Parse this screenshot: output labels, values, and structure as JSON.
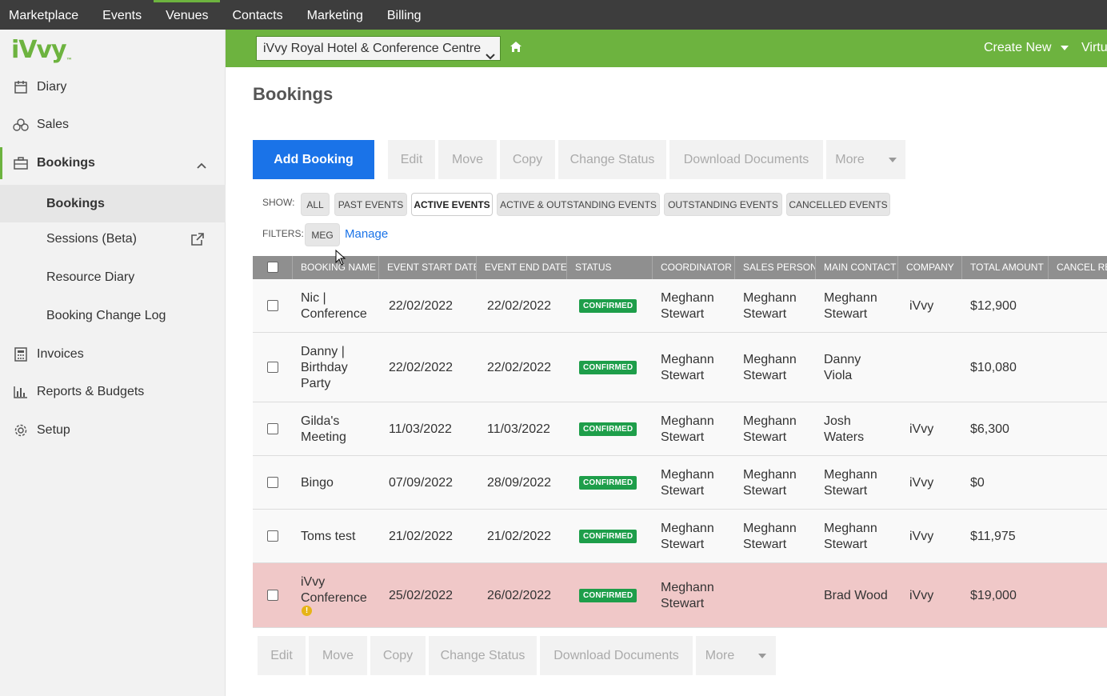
{
  "topnav": [
    "Marketplace",
    "Events",
    "Venues",
    "Contacts",
    "Marketing",
    "Billing"
  ],
  "topnav_active": "Venues",
  "logo": {
    "text": "iVvy",
    "suffix": "™"
  },
  "sidebar": {
    "diary": "Diary",
    "sales": "Sales",
    "bookings": "Bookings",
    "sub": [
      "Bookings",
      "Sessions (Beta)",
      "Resource Diary",
      "Booking Change Log"
    ],
    "invoices": "Invoices",
    "reports": "Reports & Budgets",
    "setup": "Setup"
  },
  "header": {
    "venue": "iVvy Royal Hotel & Conference Centre",
    "create_new": "Create New",
    "virtual": "Virtu"
  },
  "page_title": "Bookings",
  "toolbar": {
    "add": "Add Booking",
    "edit": "Edit",
    "move": "Move",
    "copy": "Copy",
    "change_status": "Change Status",
    "download": "Download Documents",
    "more": "More"
  },
  "show": {
    "label": "SHOW:",
    "options": [
      "ALL",
      "PAST EVENTS",
      "ACTIVE EVENTS",
      "ACTIVE & OUTSTANDING EVENTS",
      "OUTSTANDING EVENTS",
      "CANCELLED EVENTS"
    ],
    "selected": "ACTIVE EVENTS"
  },
  "filters": {
    "label": "FILTERS:",
    "chip": "MEG",
    "manage": "Manage"
  },
  "columns": [
    "BOOKING NAME",
    "EVENT START DATE",
    "EVENT END DATE",
    "STATUS",
    "COORDINATOR",
    "SALES PERSON",
    "MAIN CONTACT",
    "COMPANY",
    "TOTAL AMOUNT",
    "CANCEL RE"
  ],
  "rows": [
    {
      "name": [
        "Nic |",
        "Conference"
      ],
      "start": "22/02/2022",
      "end": "22/02/2022",
      "status": "CONFIRMED",
      "coordinator": [
        "Meghann",
        "Stewart"
      ],
      "sales": [
        "Meghann",
        "Stewart"
      ],
      "contact": [
        "Meghann",
        "Stewart"
      ],
      "company": "iVvy",
      "total": "$12,900"
    },
    {
      "name": [
        "Danny |",
        "Birthday",
        "Party"
      ],
      "start": "22/02/2022",
      "end": "22/02/2022",
      "status": "CONFIRMED",
      "coordinator": [
        "Meghann",
        "Stewart"
      ],
      "sales": [
        "Meghann",
        "Stewart"
      ],
      "contact": [
        "Danny",
        "Viola"
      ],
      "company": "",
      "total": "$10,080"
    },
    {
      "name": [
        "Gilda's",
        "Meeting"
      ],
      "start": "11/03/2022",
      "end": "11/03/2022",
      "status": "CONFIRMED",
      "coordinator": [
        "Meghann",
        "Stewart"
      ],
      "sales": [
        "Meghann",
        "Stewart"
      ],
      "contact": [
        "Josh",
        "Waters"
      ],
      "company": "iVvy",
      "total": "$6,300"
    },
    {
      "name": [
        "Bingo"
      ],
      "start": "07/09/2022",
      "end": "28/09/2022",
      "status": "CONFIRMED",
      "coordinator": [
        "Meghann",
        "Stewart"
      ],
      "sales": [
        "Meghann",
        "Stewart"
      ],
      "contact": [
        "Meghann",
        "Stewart"
      ],
      "company": "iVvy",
      "total": "$0"
    },
    {
      "name": [
        "Toms test"
      ],
      "start": "21/02/2022",
      "end": "21/02/2022",
      "status": "CONFIRMED",
      "coordinator": [
        "Meghann",
        "Stewart"
      ],
      "sales": [
        "Meghann",
        "Stewart"
      ],
      "contact": [
        "Meghann",
        "Stewart"
      ],
      "company": "iVvy",
      "total": "$11,975"
    },
    {
      "name": [
        "iVvy",
        "Conference"
      ],
      "start": "25/02/2022",
      "end": "26/02/2022",
      "status": "CONFIRMED",
      "coordinator": [
        "Meghann",
        "Stewart"
      ],
      "sales": [],
      "contact": [
        "Brad Wood"
      ],
      "company": "iVvy",
      "total": "$19,000",
      "warning": "!"
    }
  ]
}
